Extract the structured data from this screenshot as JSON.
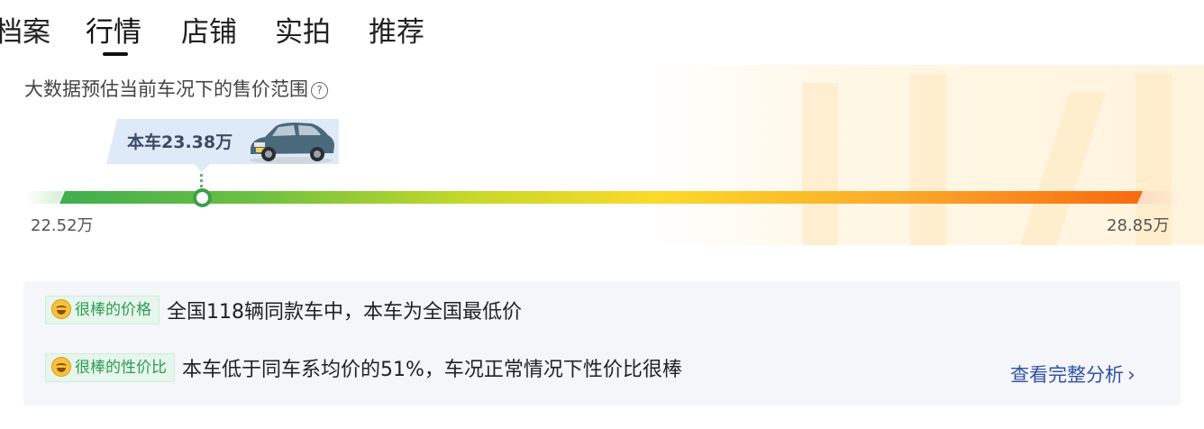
{
  "tabs": [
    {
      "label": "档案",
      "active": false
    },
    {
      "label": "行情",
      "active": true
    },
    {
      "label": "店铺",
      "active": false
    },
    {
      "label": "实拍",
      "active": false
    },
    {
      "label": "推荐",
      "active": false
    }
  ],
  "market": {
    "subtitle": "大数据预估当前车况下的售价范围",
    "help_icon": "help-circle-icon",
    "this_car_price_label": "本车23.38万",
    "this_car_price": 23.38,
    "range_min_label": "22.52万",
    "range_max_label": "28.85万",
    "range_min": 22.52,
    "range_max": 28.85,
    "bar_colors": [
      "#3fae4f",
      "#c7d82a",
      "#fbd92a",
      "#f86a0f"
    ]
  },
  "summary": {
    "rows": [
      {
        "badge": "很棒的价格",
        "icon": "happy-face-icon",
        "text": "全国118辆同款车中，本车为全国最低价"
      },
      {
        "badge": "很棒的性价比",
        "icon": "happy-face-icon",
        "text": "本车低于同车系均价的51%，车况正常情况下性价比很棒"
      }
    ],
    "link_label": "查看完整分析",
    "link_icon": "chevron-right-icon",
    "link_color": "#3151a6",
    "badge_color": "#2c9a52"
  }
}
